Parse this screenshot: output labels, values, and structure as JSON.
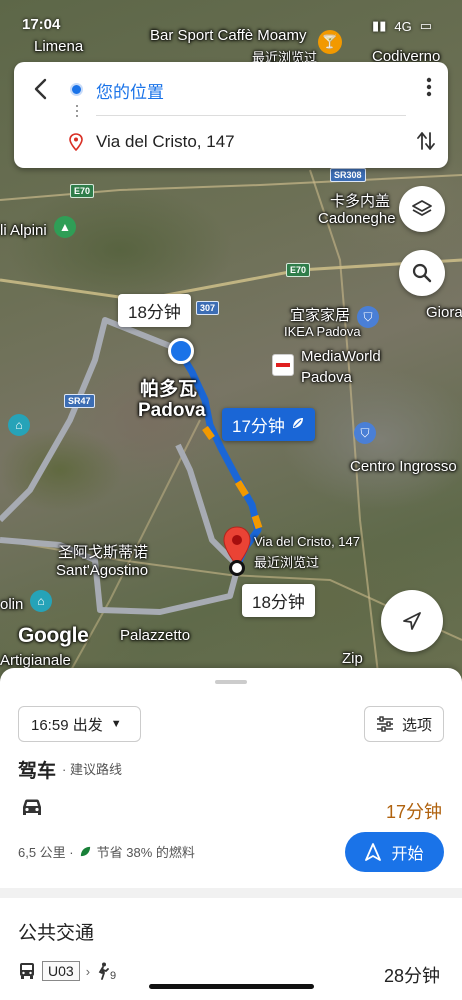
{
  "status": {
    "time": "17:04",
    "network": "4G"
  },
  "route_card": {
    "origin": "您的位置",
    "destination": "Via del Cristo, 147"
  },
  "map": {
    "labels": {
      "limena": "Limena",
      "bar": "Bar Sport Caffè Moamy",
      "bar_sub": "最近浏览过",
      "codiverno": "Codiverno",
      "alpini": "li Alpini",
      "cadoneghe_cn": "卡多内盖",
      "cadoneghe": "Cadoneghe",
      "ikea_cn": "宜家家居",
      "ikea": "IKEA Padova",
      "giora": "Giora",
      "mediaworld": "MediaWorld",
      "mediaworld_city": "Padova",
      "padova_cn": "帕多瓦",
      "padova": "Padova",
      "centro": "Centro Ingrosso",
      "dest_label": "Via del Cristo, 147",
      "dest_sub": "最近浏览过",
      "sant_cn": "圣阿戈斯蒂诺",
      "sant": "Sant'Agostino",
      "olin": "olin",
      "artigianale": "Artigianale",
      "palazzetto": "Palazzetto",
      "zip": "Zip",
      "google": "Google"
    },
    "roads": {
      "e70_a": "E70",
      "e70_b": "E70",
      "sr47": "SR47",
      "sr308": "SR308",
      "r307": "307"
    },
    "callouts": {
      "alt1": "18分钟",
      "primary": "17分钟",
      "alt2": "18分钟"
    },
    "colors": {
      "route_primary": "#1a73e8",
      "route_alt": "#b8bcc4",
      "traffic": "#f29900",
      "pin": "#ea4335"
    }
  },
  "sheet": {
    "depart": "16:59 出发",
    "options": "选项",
    "mode": "驾车",
    "mode_sub": "· 建议路线",
    "duration": "17分钟",
    "distance": "6,5 公里 ·",
    "fuel": "节省 38% 的燃料",
    "start": "开始",
    "transit_title": "公共交通",
    "bus_line": "U03",
    "walk_minutes": "9",
    "transit_duration": "28分钟"
  },
  "icons": [
    "back-arrow-icon",
    "origin-dot-icon",
    "destination-pin-icon",
    "more-vert-icon",
    "swap-icon",
    "layers-icon",
    "search-icon",
    "navigation-arrow-icon",
    "car-icon",
    "leaf-icon",
    "bus-icon",
    "walk-icon"
  ]
}
